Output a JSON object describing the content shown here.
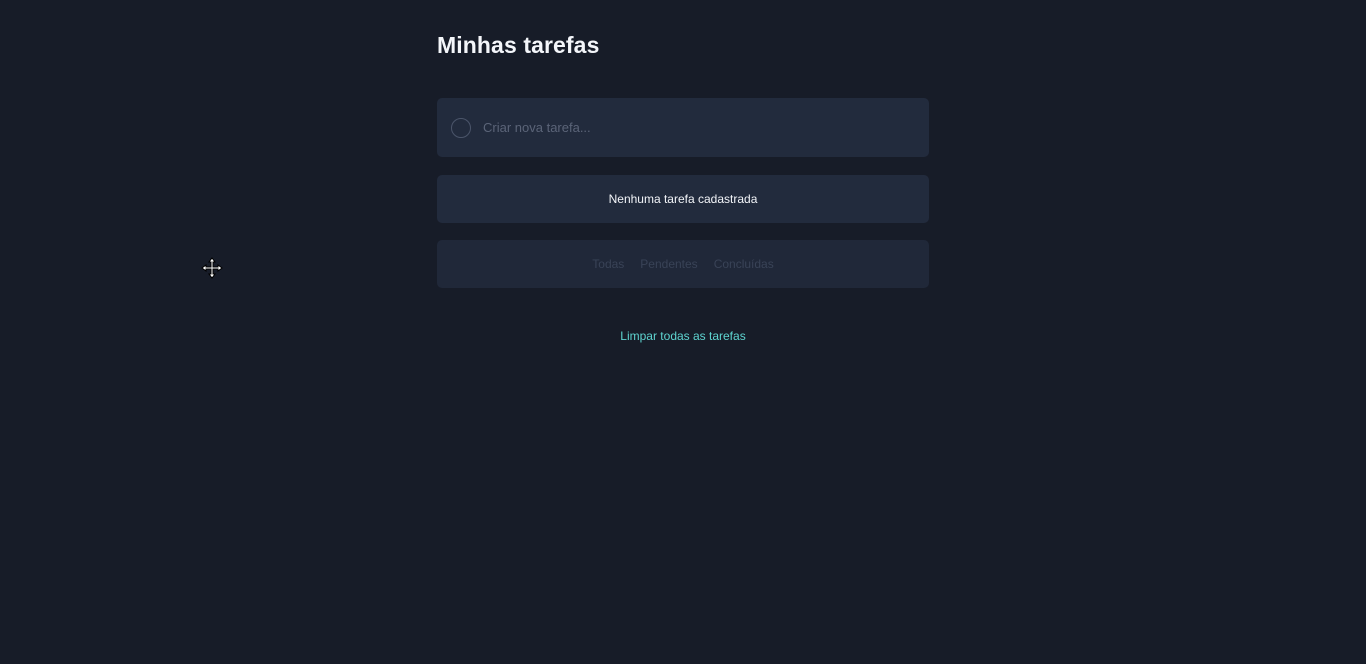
{
  "header": {
    "title": "Minhas tarefas"
  },
  "new_task": {
    "placeholder": "Criar nova tarefa..."
  },
  "task_list": {
    "empty_message": "Nenhuma tarefa cadastrada"
  },
  "filters": [
    {
      "label": "Todas"
    },
    {
      "label": "Pendentes"
    },
    {
      "label": "Concluídas"
    }
  ],
  "actions": {
    "clear_all_label": "Limpar todas as tarefas"
  },
  "colors": {
    "background": "#171c28",
    "card": "#222b3d",
    "accent": "#5ed4d0"
  },
  "cursor": {
    "icon": "move-cursor-icon"
  }
}
